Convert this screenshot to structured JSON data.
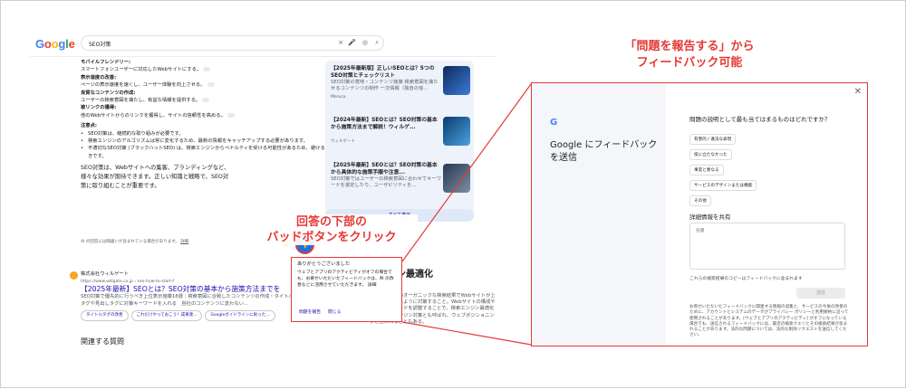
{
  "search": {
    "query": "SEO対策",
    "clear_icon": "×"
  },
  "ai_overview": {
    "items": [
      {
        "heading": "モバイルフレンドリー:",
        "text": "スマートフォンユーザーに対応したWebサイトにする。"
      },
      {
        "heading": "表示速度の改善:",
        "text": "ページの表示速度を速くし、ユーザー体験を向上させる。"
      },
      {
        "heading": "良質なコンテンツの作成:",
        "text": "ユーザーの検索意図を満たし、有益な情報を提供する。"
      },
      {
        "heading": "被リンクの獲得:",
        "text": "他のWebサイトからのリンクを獲得し、サイトの信頼性を高める。"
      }
    ],
    "notes_heading": "注意点:",
    "notes": [
      "SEO対策は、継続的な取り組みが必要です。",
      "検索エンジンのアルゴリズムは常に変化するため、最新の情報をキャッチアップする必要があります。",
      "不適切なSEO対策 (ブラックハットSEO) は、検索エンジンからペナルティを受ける可能性があるため、避けるべきです。"
    ],
    "summary": "SEO対策は、Webサイトへの集客、ブランディングなど、様々な効果が期待できます。正しい知識と戦略で、SEO対策に取り組むことが重要です。",
    "footer": "AI の回答には間違いが含まれている場合があります。",
    "footer_link": "詳細"
  },
  "side_cards": [
    {
      "title": "【2025年最新版】正しいSEOとは？5つのSEO対策とチェックリスト",
      "desc": "SEO対策の意味・コンテンツ施策 検索意図を満たせるコンテンツの制作 一次情報（独自の信...",
      "source": "Moruca"
    },
    {
      "title": "【2024年最新】SEOとは？SEO対策の基本から施策方法まで解説！ウィルゲ...",
      "desc": "",
      "source": "ウィルゲート"
    },
    {
      "title": "【2025年最新】SEOとは？SEO対策の基本から具体的な施策手順や注意...",
      "desc": "SEO対策ではユーザーの検索意図に合わせてキーワードを選定したり、ユーザビリティを...",
      "source": ""
    }
  ],
  "show_all": "すべて表示",
  "result": {
    "site": "株式会社ウィルゲート",
    "url": "https://www.willgate.co.jp › seo-how-to-start-f",
    "title": "【2025年最新】SEOとは？SEO対策の基本から施策方法までを",
    "snippet": "SEO対策で優先的に行うべき上位表示施策18選｜検索意図に合致したコンテンツの作成・タイトルタグや見出しタグに対策キーワードを入れる　自社のコンテンツに変わない...",
    "pills": [
      "タイトルタグの改善",
      "これだけやっておこう！成果達...",
      "Googleガイドラインに則った..."
    ]
  },
  "related": "関連する質問",
  "right_snippet": {
    "title": "エンジン最適化",
    "text": "検索エンジンのオーガニックな検索結果でWebサイトが上位に表示されるように対策すること。Webサイトの構成や適切なキーワードを調整することで、検索エンジン最適化なしい検索エンジン対策とも呼ばれ、ウェブポジショニングと言われることもある。"
  },
  "popup": {
    "title": "ありがとうございました",
    "text": "ウェブとアプリのアクティビティがオフの場合でも、お寄せいただいたフィードバックは、AI の改善などに活用させていただきます。 詳細",
    "link1": "問題を報告",
    "link2": "閉じる"
  },
  "callout_bottom": "回答の下部の\nバッドボタンをクリック",
  "callout_top": "「問題を報告する」から\nフィードバック可能",
  "feedback": {
    "logo": "G",
    "title": "Google にフィードバックを送信",
    "question": "問題の説明として最も当てはまるものはどれですか？",
    "options": [
      "有害的 / 違法な表現",
      "役に立たなかった",
      "事実と異なる",
      "サービスのデザインまたは機能",
      "その他"
    ],
    "detail_label": "詳細情報を共有",
    "detail_placeholder": "任意",
    "copy_note": "これらの検索結果のコピーはフィードバックに含まれます",
    "send": "送信",
    "legal": "お寄せいただいたフィードバックに関連する情報の収集と、サービスの今後の改善のために、アカウントとシステムのデータがプライバシー ポリシーと利用規約に沿って使用されることがあります。[ウェブとアプリのアクティビティ] がオフになっている場合でも、送信されるフィードバックには、最近の検索クエリとその検索結果が含まれることがあります。法的な問題については、法的な削除リクエストを送信してください。"
  },
  "colors": {
    "accent": "#e53935",
    "link": "#1a0dab",
    "blue": "#1a73e8"
  }
}
